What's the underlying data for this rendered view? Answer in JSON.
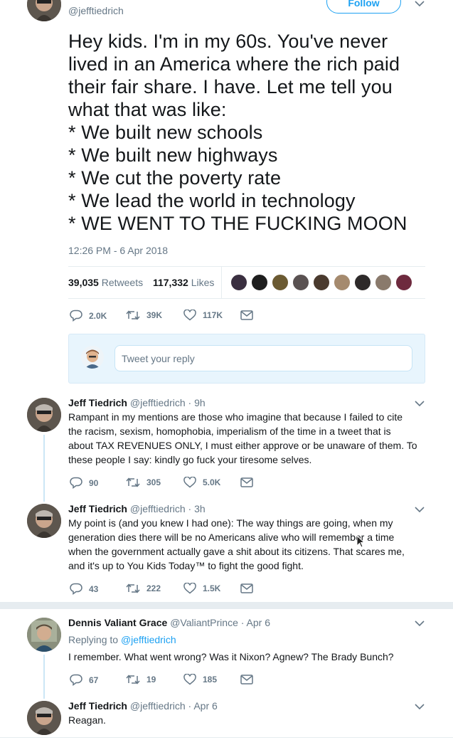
{
  "top_tweet": {
    "handle": "@jefftiedrich",
    "follow_label": "Follow",
    "text_lines": [
      "Hey kids. I'm in my 60s. You've never",
      "lived in an America where the rich paid",
      "their fair share. I have. Let me tell you",
      "what that was like:",
      "* We built new schools",
      "* We built new highways",
      "* We cut the poverty rate",
      "* We lead the world in technology",
      "* WE WENT TO THE FUCKING MOON"
    ],
    "timestamp": "12:26 PM - 6 Apr 2018",
    "retweets_count": "39,035",
    "retweets_label": "Retweets",
    "likes_count": "117,332",
    "likes_label": "Likes",
    "actions": {
      "replies": "2.0K",
      "retweets": "39K",
      "likes": "117K"
    }
  },
  "reply_composer": {
    "placeholder": "Tweet your reply"
  },
  "replies": [
    {
      "name": "Jeff Tiedrich",
      "handle": "@jefftiedrich",
      "time": "· 9h",
      "text_lines": [
        "Rampant in my mentions are those who imagine that because I failed to cite",
        "the racism, sexism, homophobia, imperialism of the time in a tweet that is",
        "about TAX REVENUES ONLY, I must either approve or be unaware of them. To",
        "these people I say: kindly go fuck your tiresome selves."
      ],
      "actions": {
        "replies": "90",
        "retweets": "305",
        "likes": "5.0K"
      }
    },
    {
      "name": "Jeff Tiedrich",
      "handle": "@jefftiedrich",
      "time": "· 3h",
      "text_lines": [
        "My point is (and you knew I had one): The way things are going, when my",
        "generation dies there will be no Americans alive who will remember a time",
        "when the government actually gave a shit about its citizens. That scares me,",
        "and it's up to You Kids Today™ to fight the good fight."
      ],
      "actions": {
        "replies": "43",
        "retweets": "222",
        "likes": "1.5K"
      }
    },
    {
      "name": "Dennis Valiant Grace",
      "handle": "@ValiantPrince",
      "time": "· Apr 6",
      "replying_prefix": "Replying to",
      "replying_to": "@jefftiedrich",
      "text_lines": [
        "I remember. What went wrong? Was it Nixon? Agnew? The Brady Bunch?"
      ],
      "actions": {
        "replies": "67",
        "retweets": "19",
        "likes": "185"
      }
    },
    {
      "name": "Jeff Tiedrich",
      "handle": "@jefftiedrich",
      "time": "· Apr 6",
      "text_lines": [
        "Reagan."
      ]
    }
  ],
  "colors": {
    "accent": "#1da1f2",
    "secondary_text": "#657786",
    "thread_line": "#cce6f6"
  }
}
